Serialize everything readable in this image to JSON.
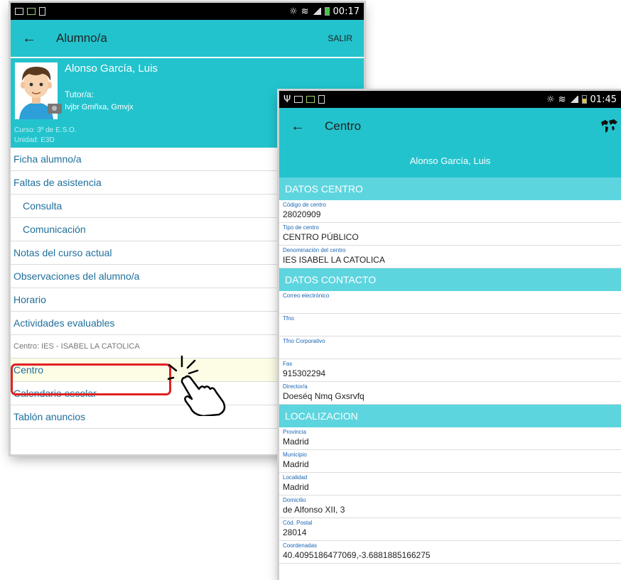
{
  "phone1": {
    "status_time": "00:17",
    "appbar_title": "Alumno/a",
    "salir_label": "SALIR",
    "student_name": "Alonso García, Luis",
    "tutor_label": "Tutor/a:",
    "tutor_name": "Ivjbr Gmñxa, Gmvjx",
    "curso": "Curso:  3º de E.S.O.",
    "unidad": "Unidad: E3D",
    "menu": {
      "ficha": "Ficha alumno/a",
      "faltas": "Faltas de asistencia",
      "consulta": "Consulta",
      "comunicacion": "Comunicación",
      "notas": "Notas del curso actual",
      "observaciones": "Observaciones del alumno/a",
      "horario": "Horario",
      "actividades": "Actividades evaluables",
      "centro_section": "Centro: IES - ISABEL LA CATOLICA",
      "centro": "Centro",
      "calendario": "Calendario escolar",
      "tablon": "Tablón anuncios"
    }
  },
  "phone2": {
    "status_time": "01:45",
    "appbar_title": "Centro",
    "student_name": "Alonso García, Luis",
    "sections": {
      "datos_centro": "DATOS CENTRO",
      "datos_contacto": "DATOS CONTACTO",
      "localizacion": "LOCALIZACION"
    },
    "fields": {
      "codigo": {
        "label": "Código de centro",
        "value": "28020909"
      },
      "tipo": {
        "label": "Tipo de centro",
        "value": "CENTRO PÚBLICO"
      },
      "denominacion": {
        "label": "Denominación del centro",
        "value": "IES ISABEL LA CATOLICA"
      },
      "correo": {
        "label": "Correo electrónico",
        "value": ""
      },
      "tfno": {
        "label": "Tfno",
        "value": ""
      },
      "tfno_corp": {
        "label": "Tfno Corporativo",
        "value": ""
      },
      "fax": {
        "label": "Fax",
        "value": "915302294"
      },
      "director": {
        "label": "Director/a",
        "value": "Doeséq Nmq Gxsrvfq"
      },
      "provincia": {
        "label": "Provincia",
        "value": "Madrid"
      },
      "municipio": {
        "label": "Municipio",
        "value": "Madrid"
      },
      "localidad": {
        "label": "Localidad",
        "value": "Madrid"
      },
      "domicilio": {
        "label": "Domicilio",
        "value": "de Alfonso XII, 3"
      },
      "cod_postal": {
        "label": "Cód. Postal",
        "value": "28014"
      },
      "coordenadas": {
        "label": "Coordenadas",
        "value": "40.4095186477069,-3.6881885166275"
      }
    }
  },
  "colors": {
    "accent": "#22c3cd",
    "section": "#5dd5df",
    "link": "#1f6f9b",
    "highlight_border": "#e02121"
  }
}
